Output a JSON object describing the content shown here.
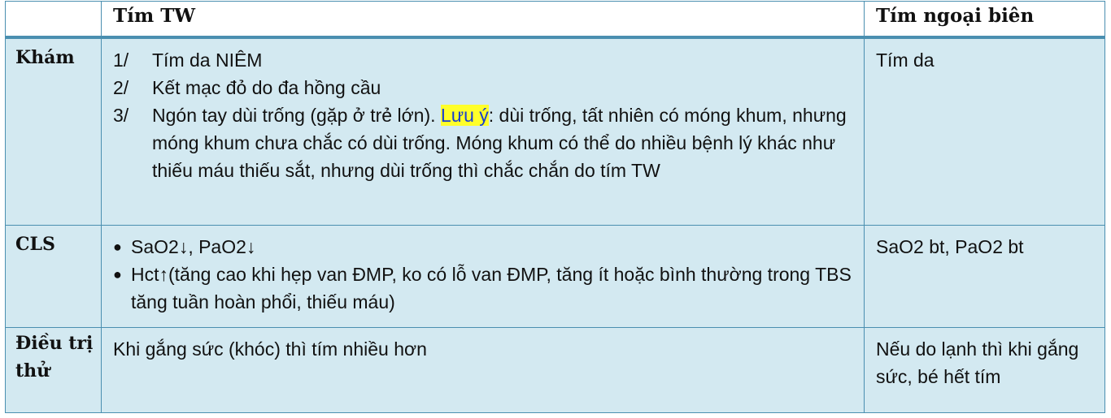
{
  "header": {
    "col0": "",
    "col1": "Tím TW",
    "col2": "Tím ngoại biên"
  },
  "rows": {
    "kham": {
      "label": "Khám",
      "items": [
        {
          "num": "1/",
          "text": "Tím da NIÊM"
        },
        {
          "num": "2/",
          "text": "Kết mạc đỏ do đa hồng cầu"
        },
        {
          "num": "3/",
          "text_before": "Ngón tay dùi trống (gặp ở trẻ lớn). ",
          "highlight": "Lưu ý",
          "text_after": ": dùi trống, tất nhiên có móng khum, nhưng móng khum chưa chắc có dùi trống. Móng khum có thể do nhiều bệnh lý khác như thiếu máu thiếu sắt, nhưng dùi trống thì chắc chắn do tím TW"
        }
      ],
      "peripheral": "Tím da"
    },
    "cls": {
      "label": "CLS",
      "bullets": [
        "SaO2↓, PaO2↓",
        "Hct↑(tăng cao khi hẹp van ĐMP, ko có lỗ van ĐMP, tăng ít hoặc bình thường trong TBS tăng tuần hoàn phổi, thiếu máu)"
      ],
      "peripheral": "SaO2 bt, PaO2 bt"
    },
    "dieutri": {
      "label": "Điều trị thử",
      "text": "Khi gắng sức (khóc) thì tím nhiều hơn",
      "peripheral": "Nếu do lạnh thì khi gắng sức, bé hết tím"
    }
  }
}
